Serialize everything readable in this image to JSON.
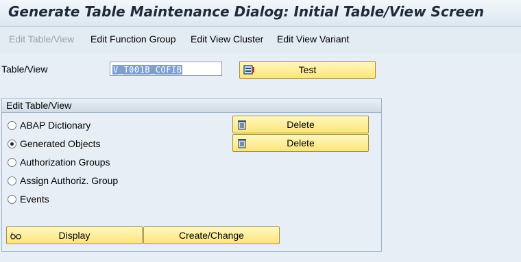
{
  "window": {
    "title": "Generate Table Maintenance Dialog: Initial Table/View Screen"
  },
  "toolbar": {
    "items": [
      {
        "label": "Edit Table/View",
        "enabled": false
      },
      {
        "label": "Edit Function Group",
        "enabled": true
      },
      {
        "label": "Edit View Cluster",
        "enabled": true
      },
      {
        "label": "Edit View Variant",
        "enabled": true
      }
    ]
  },
  "table_view": {
    "label": "Table/View",
    "value": "V_T001B_COFIB",
    "test_button": {
      "label": "Test",
      "icon": "test-icon"
    }
  },
  "edit_group": {
    "title": "Edit Table/View",
    "options": [
      {
        "label": "ABAP Dictionary",
        "selected": false
      },
      {
        "label": "Generated Objects",
        "selected": true
      },
      {
        "label": "Authorization Groups",
        "selected": false
      },
      {
        "label": "Assign Authoriz. Group",
        "selected": false
      },
      {
        "label": "Events",
        "selected": false
      }
    ],
    "delete_buttons": [
      {
        "label": "Delete",
        "icon": "trash-icon"
      },
      {
        "label": "Delete",
        "icon": "trash-icon"
      }
    ],
    "display_button": {
      "label": "Display",
      "icon": "glasses-icon"
    },
    "create_change_button": {
      "label": "Create/Change"
    }
  },
  "colors": {
    "background": "#e8eef5",
    "button_fill": "#fde57a",
    "selection": "#7fa0cc",
    "title_text": "#1d2a3a"
  }
}
